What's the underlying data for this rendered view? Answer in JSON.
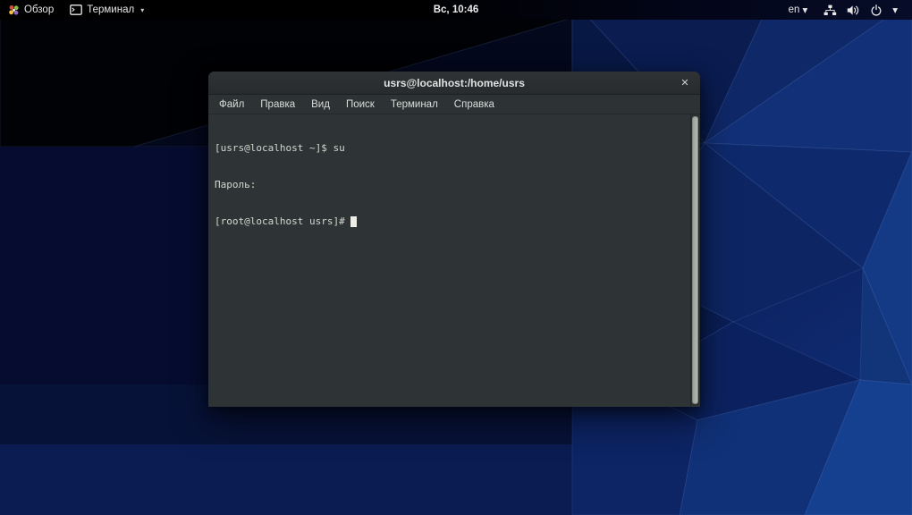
{
  "top_bar": {
    "activities": {
      "label": "Обзор"
    },
    "app_menu": {
      "label": "Терминал",
      "chevron": "▾"
    },
    "clock": "Вс, 10:46",
    "system": {
      "keyboard_layout": "en",
      "keyboard_chevron": "▾",
      "menu_chevron": "▾"
    }
  },
  "terminal_window": {
    "title": "usrs@localhost:/home/usrs",
    "close": "✕",
    "menu_items": [
      "Файл",
      "Правка",
      "Вид",
      "Поиск",
      "Терминал",
      "Справка"
    ],
    "lines": [
      "[usrs@localhost ~]$ su",
      "Пароль:",
      "[root@localhost usrs]# "
    ]
  },
  "colors": {
    "top_bar_bg": "#000000",
    "wallpaper_dark": "#010309",
    "wallpaper_blue_mid": "#0d2465",
    "wallpaper_blue_bright": "#154090",
    "terminal_bg": "#2e3436",
    "terminal_fg": "#d3d7cf",
    "titlebar_bg": "#2b2e30",
    "menubar_bg": "#2d3234",
    "scrollbar_thumb": "#aab0a8",
    "cursor": "#eceee7"
  }
}
